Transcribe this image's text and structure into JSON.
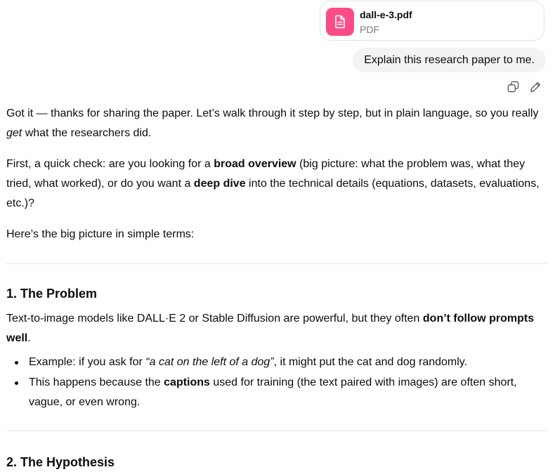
{
  "attachment": {
    "file_name": "dall-e-3.pdf",
    "file_type": "PDF",
    "icon": "document-icon",
    "icon_color": "#fa4c87"
  },
  "user_message": "Explain this research paper to me.",
  "message_actions": {
    "copy_icon": "copy-icon",
    "edit_icon": "pencil-icon"
  },
  "response": {
    "intro": {
      "a": "Got it — thanks for sharing the paper. Let’s walk through it step by step, but in plain language, so you really ",
      "em": "get",
      "b": " what the researchers did."
    },
    "check": {
      "a": "First, a quick check: are you looking for a ",
      "bold1": "broad overview",
      "b": " (big picture: what the problem was, what they tried, what worked), or do you want a ",
      "bold2": "deep dive",
      "c": " into the technical details (equations, datasets, evaluations, etc.)?"
    },
    "big_picture": "Here’s the big picture in simple terms:",
    "section1": {
      "heading": "1. The Problem",
      "para": {
        "a": "Text-to-image models like DALL·E 2 or Stable Diffusion are powerful, but they often ",
        "bold": "don’t follow prompts well",
        "b": "."
      },
      "bullets": [
        {
          "a": "Example: if you ask for ",
          "em": "“a cat on the left of a dog”",
          "b": ", it might put the cat and dog randomly."
        },
        {
          "a": "This happens because the ",
          "bold": "captions",
          "b": " used for training (the text paired with images) are often short, vague, or even wrong."
        }
      ]
    },
    "section2": {
      "heading": "2. The Hypothesis"
    }
  }
}
